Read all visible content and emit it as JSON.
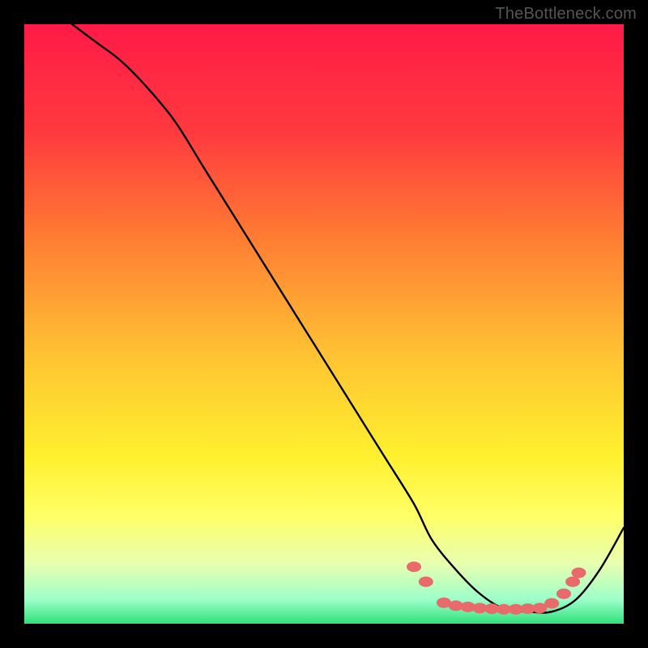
{
  "watermark": "TheBottleneck.com",
  "chart_data": {
    "type": "line",
    "title": "",
    "xlabel": "",
    "ylabel": "",
    "xlim": [
      0,
      100
    ],
    "ylim": [
      0,
      100
    ],
    "axes_visible": false,
    "grid": false,
    "background": {
      "type": "vertical-gradient",
      "stops": [
        {
          "pos": 0.0,
          "color": "#ff1a47"
        },
        {
          "pos": 0.18,
          "color": "#ff3a3f"
        },
        {
          "pos": 0.35,
          "color": "#ff7a33"
        },
        {
          "pos": 0.55,
          "color": "#ffc233"
        },
        {
          "pos": 0.72,
          "color": "#fff02e"
        },
        {
          "pos": 0.82,
          "color": "#ffff66"
        },
        {
          "pos": 0.9,
          "color": "#e7ffb0"
        },
        {
          "pos": 0.96,
          "color": "#9cffc9"
        },
        {
          "pos": 1.0,
          "color": "#30e07a"
        }
      ]
    },
    "series": [
      {
        "name": "bottleneck-curve",
        "stroke": "#000000",
        "stroke_width": 2.4,
        "x": [
          8,
          12,
          16,
          20,
          25,
          30,
          35,
          40,
          45,
          50,
          55,
          60,
          65,
          68,
          72,
          76,
          80,
          84,
          88,
          92,
          96,
          100
        ],
        "y": [
          100,
          97,
          94,
          90,
          84,
          76,
          68,
          60,
          52,
          44,
          36,
          28,
          20,
          14,
          9,
          5,
          2.5,
          2,
          2,
          4,
          9,
          16
        ]
      }
    ],
    "markers": {
      "name": "optimal-zone-dots",
      "shape": "ellipse",
      "fill": "#e86a6a",
      "rx": 9,
      "ry": 6.5,
      "points": [
        {
          "x": 65,
          "y": 9.5
        },
        {
          "x": 67,
          "y": 7.0
        },
        {
          "x": 70,
          "y": 3.5
        },
        {
          "x": 72,
          "y": 3.0
        },
        {
          "x": 74,
          "y": 2.8
        },
        {
          "x": 76,
          "y": 2.6
        },
        {
          "x": 78,
          "y": 2.5
        },
        {
          "x": 80,
          "y": 2.4
        },
        {
          "x": 82,
          "y": 2.4
        },
        {
          "x": 84,
          "y": 2.5
        },
        {
          "x": 86,
          "y": 2.6
        },
        {
          "x": 88,
          "y": 3.4
        },
        {
          "x": 90,
          "y": 5.0
        },
        {
          "x": 91.5,
          "y": 7.0
        },
        {
          "x": 92.5,
          "y": 8.5
        }
      ]
    }
  }
}
